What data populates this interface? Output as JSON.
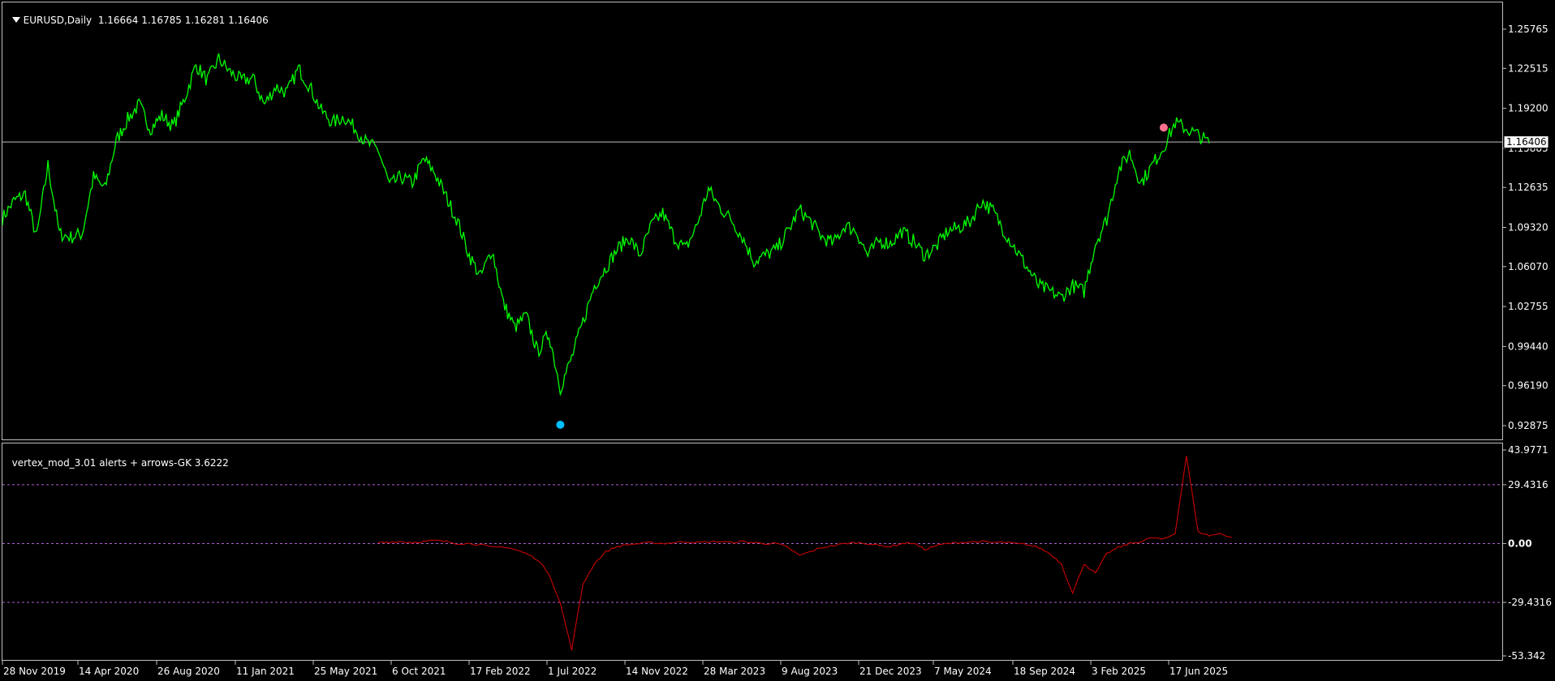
{
  "main_panel": {
    "symbol": "EURUSD,Daily",
    "ohlc": "1.16664 1.16785 1.16281 1.16406",
    "price_scale": [
      "1.25765",
      "1.22515",
      "1.19200",
      "1.15885",
      "1.12635",
      "1.09320",
      "1.06070",
      "1.02755",
      "0.99440",
      "0.96190",
      "0.92875"
    ],
    "current_price_label": "1.16406",
    "current_price": 1.16406
  },
  "indicator_panel": {
    "label": "vertex_mod_3.01 alerts + arrows-GK 3.6222",
    "scale": [
      "43.9771",
      "29.4316",
      "0.00",
      "-29.4316",
      "-53.342"
    ],
    "levels": [
      29.4316,
      0,
      -29.4316
    ]
  },
  "time_axis": [
    "28 Nov 2019",
    "14 Apr 2020",
    "26 Aug 2020",
    "11 Jan 2021",
    "25 May 2021",
    "6 Oct 2021",
    "17 Feb 2022",
    "1 Jul 2022",
    "14 Nov 2022",
    "28 Mar 2023",
    "9 Aug 2023",
    "21 Dec 2023",
    "7 May 2024",
    "18 Sep 2024",
    "3 Feb 2025",
    "17 Jun 2025"
  ],
  "colors": {
    "background": "#000000",
    "price_line": "#00ff00",
    "indicator_line": "#cc0000",
    "level_line": "#b060d0",
    "grid_frame": "#c0c0c0",
    "buy_dot": "#00bfff",
    "sell_dot": "#ff6f8f"
  },
  "chart_data": {
    "type": "line",
    "series": [
      {
        "values": [
          1.101,
          1.115,
          1.121,
          1.085,
          1.145,
          1.088,
          1.085,
          1.088,
          1.135,
          1.125,
          1.165,
          1.183,
          1.195,
          1.175,
          1.186,
          1.177,
          1.2,
          1.228,
          1.215,
          1.233,
          1.222,
          1.215,
          1.217,
          1.195,
          1.21,
          1.205,
          1.225,
          1.21,
          1.19,
          1.18,
          1.185,
          1.175,
          1.163,
          1.158,
          1.128,
          1.135,
          1.13,
          1.15,
          1.138,
          1.118,
          1.098,
          1.07,
          1.052,
          1.075,
          1.03,
          1.01,
          1.02,
          0.99,
          1.005,
          0.96,
          0.985,
          1.015,
          1.045,
          1.06,
          1.075,
          1.085,
          1.07,
          1.095,
          1.105,
          1.085,
          1.075,
          1.095,
          1.125,
          1.11,
          1.1,
          1.085,
          1.065,
          1.07,
          1.075,
          1.09,
          1.108,
          1.098,
          1.085,
          1.08,
          1.095,
          1.09,
          1.07,
          1.082,
          1.08,
          1.09,
          1.082,
          1.07,
          1.077,
          1.09,
          1.093,
          1.098,
          1.115,
          1.107,
          1.09,
          1.075,
          1.06,
          1.045,
          1.04,
          1.035,
          1.045,
          1.04,
          1.08,
          1.1,
          1.14,
          1.155,
          1.13,
          1.145,
          1.16,
          1.18,
          1.175,
          1.17,
          1.163
        ]
      },
      {
        "values": [
          null,
          null,
          null,
          null,
          null,
          null,
          null,
          null,
          null,
          null,
          null,
          null,
          null,
          null,
          null,
          null,
          null,
          null,
          null,
          null,
          null,
          null,
          null,
          null,
          null,
          null,
          null,
          null,
          null,
          null,
          null,
          null,
          null,
          0.5,
          0.8,
          1.0,
          0.5,
          1.0,
          1.5,
          1.0,
          0,
          0,
          -0.5,
          -2,
          -1.5,
          -3,
          -5,
          -8,
          -15,
          -30,
          -53,
          -20,
          -10,
          -4,
          -1.5,
          -0.5,
          0,
          0.5,
          0,
          0.5,
          1.0,
          0.5,
          0.8,
          1.0,
          0.5,
          1.0,
          0.5,
          0,
          0,
          -2,
          -6,
          -4,
          -2,
          -1,
          0,
          0.5,
          0,
          -1,
          -1.5,
          0,
          0.3,
          -3,
          -1,
          0,
          0.5,
          0.8,
          1,
          0.5,
          0.6,
          0,
          -0.5,
          -2,
          -5,
          -10,
          -25,
          -10,
          -15,
          -5,
          -2,
          0,
          1,
          3,
          2,
          5,
          43.9,
          6,
          4,
          5,
          3
        ]
      }
    ],
    "x": [
      "28 Nov 2019",
      "14 Apr 2020",
      "26 Aug 2020",
      "11 Jan 2021",
      "25 May 2021",
      "6 Oct 2021",
      "17 Feb 2022",
      "1 Jul 2022",
      "14 Nov 2022",
      "28 Mar 2023",
      "9 Aug 2023",
      "21 Dec 2023",
      "7 May 2024",
      "18 Sep 2024",
      "3 Feb 2025",
      "17 Jun 2025"
    ],
    "ylim": [
      0.92875,
      1.268
    ],
    "indicator_ylim": [
      -53.342,
      43.9771
    ],
    "markers": [
      {
        "type": "buy",
        "x_index": 49,
        "value": 0.9295
      },
      {
        "type": "sell",
        "x_index": 102,
        "value": 1.176
      }
    ],
    "grid": false
  }
}
